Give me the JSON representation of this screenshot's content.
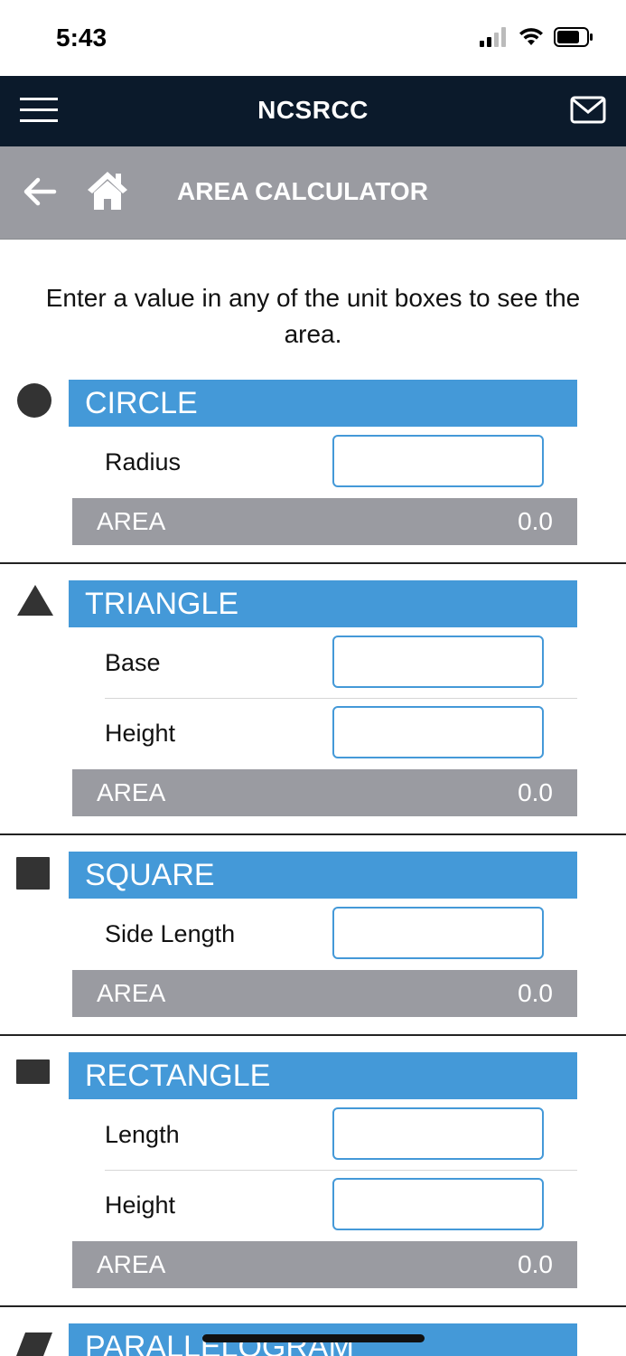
{
  "status": {
    "time": "5:43"
  },
  "navbar": {
    "title": "NCSRCC",
    "menu_icon": "hamburger-icon",
    "mail_icon": "mail-icon"
  },
  "subbar": {
    "title": "AREA CALCULATOR",
    "back_icon": "arrow-left-icon",
    "home_icon": "home-icon"
  },
  "intro": "Enter a value in any of the unit boxes to see the area.",
  "colors": {
    "navbar": "#0b1a2b",
    "subbar": "#9a9ba1",
    "section_header": "#4499d8",
    "area_bar": "#9a9ba1",
    "shape_icon": "#333333"
  },
  "sections": [
    {
      "name": "CIRCLE",
      "icon": "circle-icon",
      "fields": [
        {
          "label": "Radius",
          "value": ""
        }
      ],
      "area_label": "AREA",
      "area_value": "0.0"
    },
    {
      "name": "TRIANGLE",
      "icon": "triangle-icon",
      "fields": [
        {
          "label": "Base",
          "value": ""
        },
        {
          "label": "Height",
          "value": ""
        }
      ],
      "area_label": "AREA",
      "area_value": "0.0"
    },
    {
      "name": "SQUARE",
      "icon": "square-icon",
      "fields": [
        {
          "label": "Side Length",
          "value": ""
        }
      ],
      "area_label": "AREA",
      "area_value": "0.0"
    },
    {
      "name": "RECTANGLE",
      "icon": "rectangle-icon",
      "fields": [
        {
          "label": "Length",
          "value": ""
        },
        {
          "label": "Height",
          "value": ""
        }
      ],
      "area_label": "AREA",
      "area_value": "0.0"
    },
    {
      "name": "PARALLELOGRAM",
      "icon": "parallelogram-icon"
    }
  ]
}
